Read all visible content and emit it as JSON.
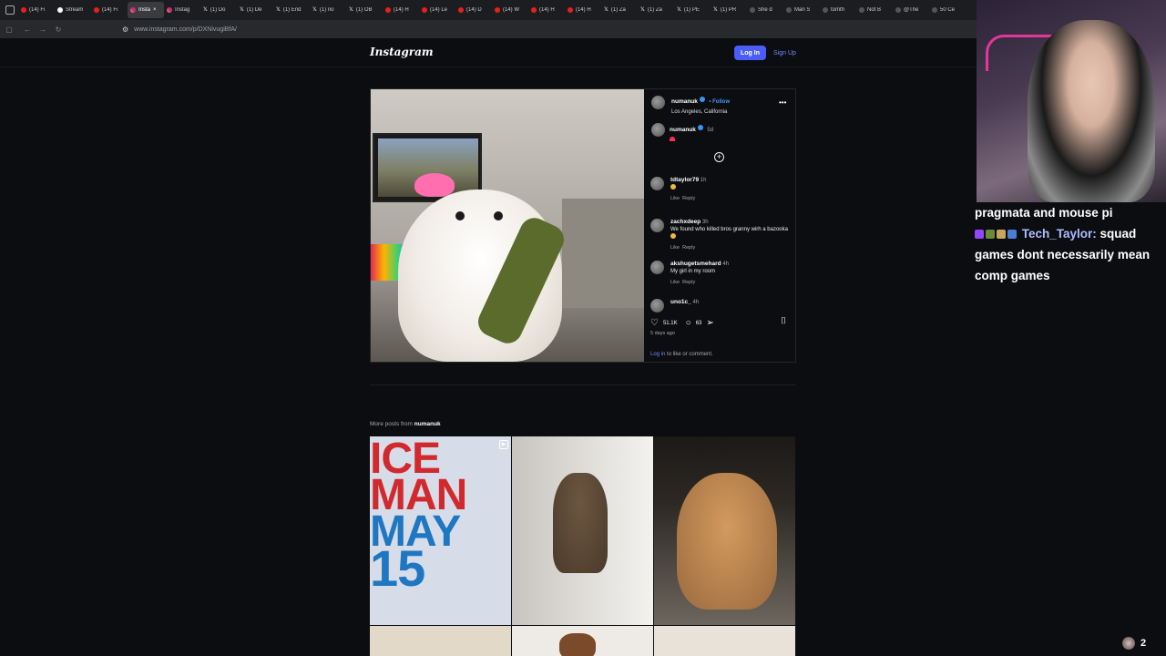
{
  "tabs": [
    {
      "icon": "youtube-icon",
      "type": "yt",
      "label": "(14) Fi",
      "active": false
    },
    {
      "icon": "stream-icon",
      "type": "tw",
      "label": "Stream",
      "active": false
    },
    {
      "icon": "youtube-icon",
      "type": "yt",
      "label": "(14) Fi",
      "active": false
    },
    {
      "icon": "instagram-icon",
      "type": "ig",
      "label": "Insta",
      "active": true
    },
    {
      "icon": "instagram-icon",
      "type": "ig",
      "label": "Instag",
      "active": false
    },
    {
      "icon": "x-icon",
      "type": "x",
      "label": "(1) Do",
      "active": false
    },
    {
      "icon": "x-icon",
      "type": "x",
      "label": "(1) De",
      "active": false
    },
    {
      "icon": "x-icon",
      "type": "x",
      "label": "(1) End",
      "active": false
    },
    {
      "icon": "x-icon",
      "type": "x",
      "label": "(1) no",
      "active": false
    },
    {
      "icon": "x-icon",
      "type": "x",
      "label": "(1) OB",
      "active": false
    },
    {
      "icon": "youtube-icon",
      "type": "yt",
      "label": "(14) H",
      "active": false
    },
    {
      "icon": "youtube-icon",
      "type": "yt",
      "label": "(14) Le",
      "active": false
    },
    {
      "icon": "youtube-icon",
      "type": "yt",
      "label": "(14) D",
      "active": false
    },
    {
      "icon": "youtube-icon",
      "type": "yt",
      "label": "(14) W",
      "active": false
    },
    {
      "icon": "youtube-icon",
      "type": "yt",
      "label": "(14) H",
      "active": false
    },
    {
      "icon": "youtube-icon",
      "type": "yt",
      "label": "(14) H",
      "active": false
    },
    {
      "icon": "x-icon",
      "type": "x",
      "label": "(1) Za",
      "active": false
    },
    {
      "icon": "x-icon",
      "type": "x",
      "label": "(1) Za",
      "active": false
    },
    {
      "icon": "x-icon",
      "type": "x",
      "label": "(1) PE",
      "active": false
    },
    {
      "icon": "x-icon",
      "type": "x",
      "label": "(1) PR",
      "active": false
    },
    {
      "icon": "tiktok-icon",
      "type": "tt",
      "label": "She d",
      "active": false
    },
    {
      "icon": "tiktok-icon",
      "type": "tt",
      "label": "Man S",
      "active": false
    },
    {
      "icon": "tiktok-icon",
      "type": "tt",
      "label": "tomth",
      "active": false
    },
    {
      "icon": "tiktok-icon",
      "type": "tt",
      "label": "Not B",
      "active": false
    },
    {
      "icon": "tiktok-icon",
      "type": "tt",
      "label": "@The",
      "active": false
    },
    {
      "icon": "tiktok-icon",
      "type": "tt",
      "label": "50 Ce",
      "active": false
    }
  ],
  "browser": {
    "url": "www.instagram.com/p/DXNivugiBfA/"
  },
  "header": {
    "logo": "Instagram",
    "login": "Log In",
    "signup": "Sign Up"
  },
  "post": {
    "username": "numanuk",
    "follow": "• Follow",
    "location": "Los Angeles, California",
    "caption_user": "numanuk",
    "caption_age": "5d",
    "comments": [
      {
        "user": "tdtaylor79",
        "age": "1h",
        "text": "",
        "like": "Like",
        "reply": "Reply"
      },
      {
        "user": "zachxdeep",
        "age": "3h",
        "text": "We found who killed bros granny wirh a bazooka",
        "like": "Like",
        "reply": "Reply"
      },
      {
        "user": "akshugetsmehard",
        "age": "4h",
        "text": "My girl in my room",
        "like": "Like",
        "reply": "Reply"
      },
      {
        "user": "uno1c_",
        "age": "4h",
        "text": "",
        "like": "",
        "reply": ""
      }
    ],
    "likes": "51.1K",
    "comment_count": "63",
    "time": "5 days ago",
    "login_link": "Log in",
    "login_rest": " to like or comment."
  },
  "more": {
    "prefix": "More posts from ",
    "user": "numanuk"
  },
  "grid_text": {
    "line1": "ICE",
    "line2": "MAN",
    "line3": "MAY",
    "line4": "15"
  },
  "chat": {
    "line0": "pragmata and mouse pi",
    "user": "Tech_Taylor:",
    "msg1": " squad",
    "msg2": "games dont necessarily mean",
    "msg3": "comp games"
  },
  "viewers": "2",
  "colors": {
    "accent": "#4a5df9",
    "link": "#6c8cff",
    "bg": "#0b0d10",
    "chat_user": "#aebdff"
  }
}
